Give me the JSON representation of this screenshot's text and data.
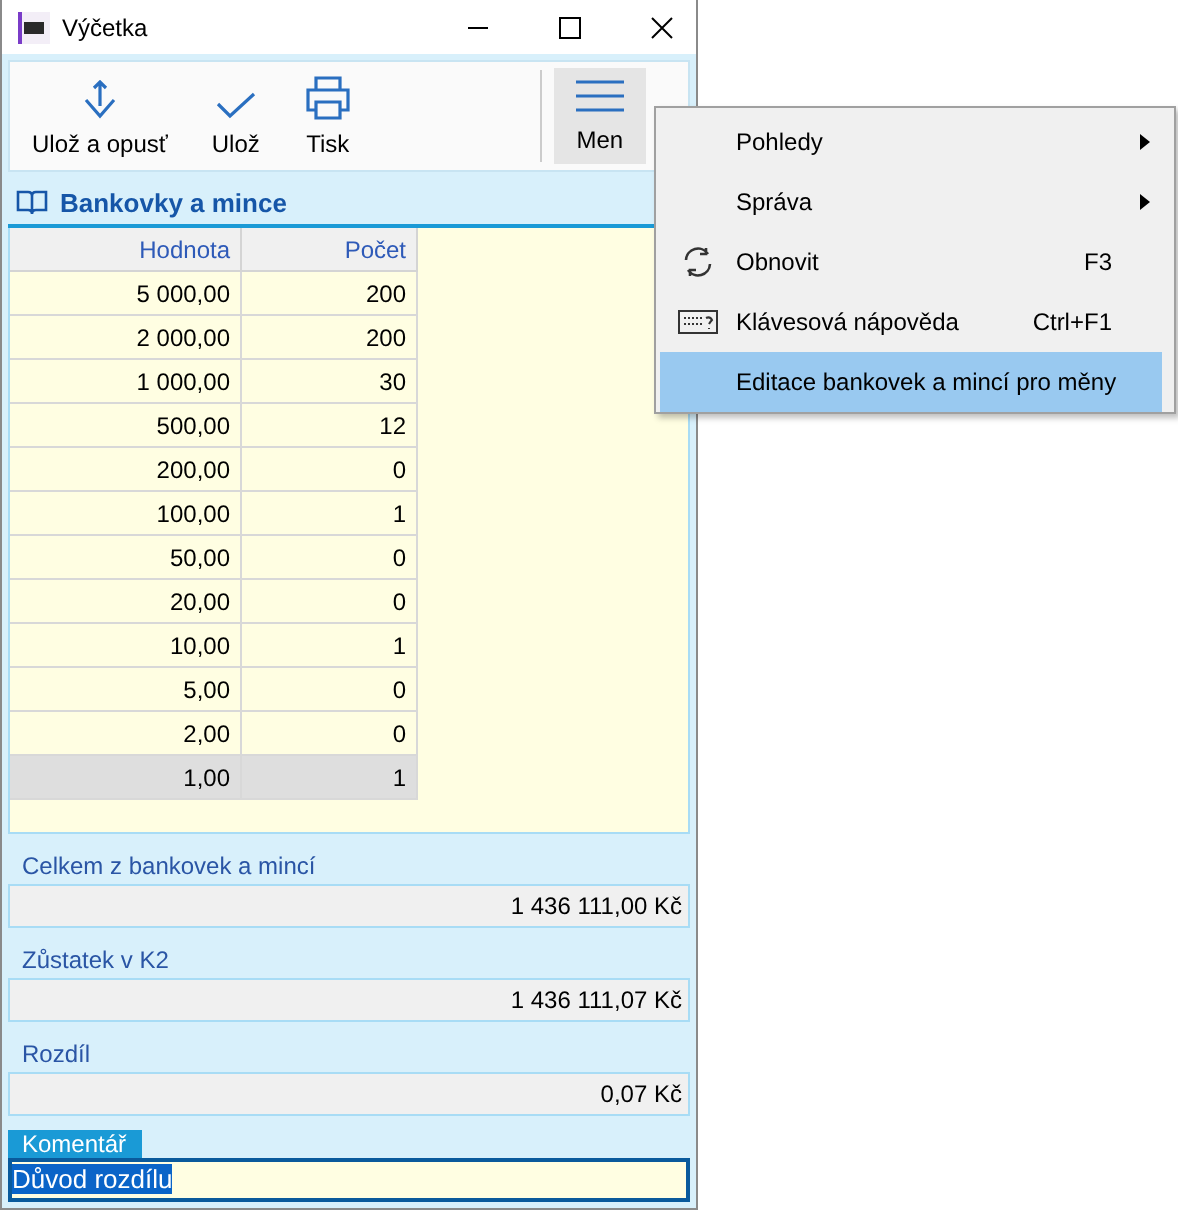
{
  "window": {
    "title": "Výčetka"
  },
  "toolbar": [
    {
      "kind": "save-exit",
      "label": "Ulož a opusť"
    },
    {
      "kind": "save",
      "label": "Ulož"
    },
    {
      "kind": "print",
      "label": "Tisk"
    }
  ],
  "menu_button": {
    "label": "Men"
  },
  "section": {
    "title": "Bankovky a mince"
  },
  "table": {
    "columns": [
      "Hodnota",
      "Počet"
    ],
    "rows": [
      {
        "value": "5 000,00",
        "count": "200",
        "selected": false
      },
      {
        "value": "2 000,00",
        "count": "200",
        "selected": false
      },
      {
        "value": "1 000,00",
        "count": "30",
        "selected": false
      },
      {
        "value": "500,00",
        "count": "12",
        "selected": false
      },
      {
        "value": "200,00",
        "count": "0",
        "selected": false
      },
      {
        "value": "100,00",
        "count": "1",
        "selected": false
      },
      {
        "value": "50,00",
        "count": "0",
        "selected": false
      },
      {
        "value": "20,00",
        "count": "0",
        "selected": false
      },
      {
        "value": "10,00",
        "count": "1",
        "selected": false
      },
      {
        "value": "5,00",
        "count": "0",
        "selected": false
      },
      {
        "value": "2,00",
        "count": "0",
        "selected": false
      },
      {
        "value": "1,00",
        "count": "1",
        "selected": true
      }
    ]
  },
  "summary": [
    {
      "label": "Celkem z bankovek a mincí",
      "value": "1 436 111,00 Kč"
    },
    {
      "label": "Zůstatek v K2",
      "value": "1 436 111,07 Kč"
    },
    {
      "label": "Rozdíl",
      "value": "0,07 Kč"
    }
  ],
  "comment": {
    "label": "Komentář",
    "value": "Důvod rozdílu"
  },
  "context_menu": [
    {
      "label": "Pohledy",
      "submenu": true,
      "selected": false
    },
    {
      "label": "Správa",
      "submenu": true,
      "selected": false
    },
    {
      "label": "Obnovit",
      "kind": "refresh",
      "shortcut": "F3",
      "selected": false
    },
    {
      "label": "Klávesová nápověda",
      "kind": "keyboard",
      "shortcut": "Ctrl+F1",
      "selected": false
    },
    {
      "label": "Editace bankovek a mincí pro měny",
      "selected": true
    }
  ]
}
